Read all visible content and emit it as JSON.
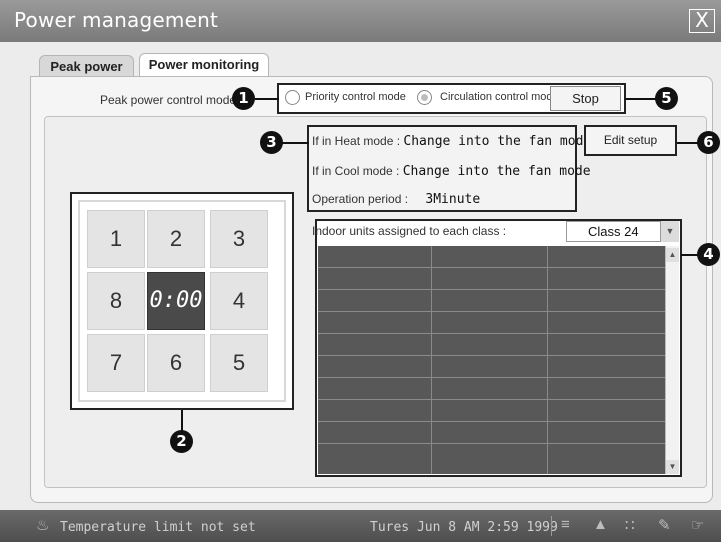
{
  "window": {
    "title": "Power management",
    "close_symbol": "X"
  },
  "tabs": [
    {
      "label": "Peak power",
      "active": false
    },
    {
      "label": "Power monitoring",
      "active": true
    }
  ],
  "control": {
    "mode_label": "Peak power control mode",
    "options": [
      {
        "label": "Priority control mode",
        "selected": false
      },
      {
        "label": "Circulation control mode",
        "selected": true
      }
    ],
    "stop_label": "Stop"
  },
  "info": {
    "heat_label": "If in Heat mode :",
    "heat_value": "Change into the fan mode",
    "cool_label": "If in Cool mode :",
    "cool_value": "Change into the fan mode",
    "period_label": "Operation period :",
    "period_value": "3Minute"
  },
  "edit_setup_label": "Edit setup",
  "keypad": {
    "cells": [
      "1",
      "2",
      "3",
      "8",
      "0:00",
      "4",
      "7",
      "6",
      "5"
    ]
  },
  "units": {
    "label": "Indoor units assigned to each class :",
    "class_value": "Class 24"
  },
  "callouts": [
    "1",
    "2",
    "3",
    "4",
    "5",
    "6"
  ],
  "taskbar": {
    "status_icon": "thermometer-icon",
    "status_text": "Temperature limit not set",
    "datetime": "Tures Jun 8 AM 2:59 1999",
    "tray_icons": [
      "list-icon",
      "chart-icon",
      "dots-icon",
      "brush-icon",
      "hand-icon"
    ]
  },
  "colors": {
    "titlebar": "#8a8a8a",
    "grid": "#585858",
    "keypad_center": "#4a4a4a",
    "taskbar": "#5a5a5a"
  }
}
